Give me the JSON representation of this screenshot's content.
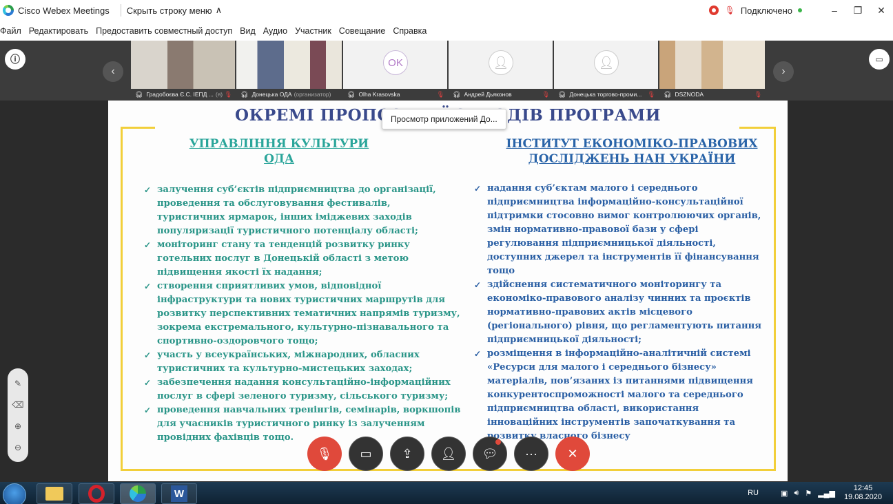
{
  "window": {
    "app_name": "Cisco Webex Meetings",
    "hide_menu": "Скрыть строку меню",
    "status": "Подключено",
    "controls": {
      "minimize": "–",
      "maximize": "❐",
      "close": "✕"
    }
  },
  "menu": [
    "Файл",
    "Редактировать",
    "Предоставить совместный доступ",
    "Вид",
    "Аудио",
    "Участник",
    "Совещание",
    "Справка"
  ],
  "participants": [
    {
      "name": "Градобоєва Є.С. ІЕПД ...",
      "role": "(я)",
      "muted": true
    },
    {
      "name": "Донецька ОДА",
      "role": "(организатор)",
      "muted": false
    },
    {
      "name": "Olha Krasovska",
      "initials": "OK",
      "muted": true
    },
    {
      "name": "Андрей Дьяконов",
      "muted": true
    },
    {
      "name": "Донецька торгово-проми...",
      "muted": true
    },
    {
      "name": "DSZNODA",
      "muted": true
    }
  ],
  "tooltip": "Просмотр приложений До...",
  "slide": {
    "title": "ОКРЕМІ ПРОПОЗИЦІЇ ЗАХОДІВ ПРОГРАМИ",
    "left_heading_1": "УПРАВЛІННЯ КУЛЬТУРИ",
    "left_heading_2": "ОДА",
    "right_heading_1": "ІНСТИТУТ ЕКОНОМІКО-ПРАВОВИХ",
    "right_heading_2": "ДОСЛІДЖЕНЬ НАН УКРАЇНИ",
    "left_items": [
      "залучення суб’єктів підприємництва до організації, проведення та обслуговування фестивалів, туристичних ярмарок, інших іміджевих заходів популяризації туристичного потенціалу області;",
      "моніторинг стану та тенденцій розвитку ринку готельних послуг в Донецькій області з метою підвищення якості їх надання;",
      "створення сприятливих умов, відповідної інфраструктури та нових туристичних маршрутів для розвитку перспективних тематичних напрямів туризму, зокрема екстремального, культурно-пізнавального та спортивно-оздоровчого тощо;",
      "участь у всеукраїнських, міжнародних, обласних туристичних та культурно-мистецьких заходах;",
      "забезпечення надання консультаційно-інформаційних послуг в сфері зеленого туризму, сільського туризму;",
      "проведення навчальних тренінгів, семінарів, воркшопів для учасників туристичного ринку із залученням провідних фахівців тощо."
    ],
    "right_items": [
      "надання суб’єктам малого і середнього підприємництва інформаційно-консультаційної підтримки стосовно вимог контролюючих органів, змін нормативно-правової бази у сфері регулювання підприємницької діяльності, доступних джерел та інструментів її фінансування тощо",
      " здійснення систематичного моніторингу та економіко-правового аналізу чинних та проєктів нормативно-правових актів місцевого (регіонального) рівня, що регламентують питання підприємницької діяльності;",
      "розміщення в інформаційно-аналітичній системі «Ресурси для малого і середнього бізнесу» матеріалів, пов’язаних із питаннями підвищення конкурентоспроможності малого та середнього підприємництва області, використання інноваційних інструментів започаткування та розвитку власного бізнесу"
    ]
  },
  "taskbar": {
    "lang": "RU",
    "time": "12:45",
    "date": "19.08.2020"
  },
  "colors": {
    "slide_title": "#3a4a8c",
    "left_text": "#2a9588",
    "right_text": "#2a5fa4",
    "frame": "#f2cf3a",
    "end_call": "#e0493b"
  }
}
